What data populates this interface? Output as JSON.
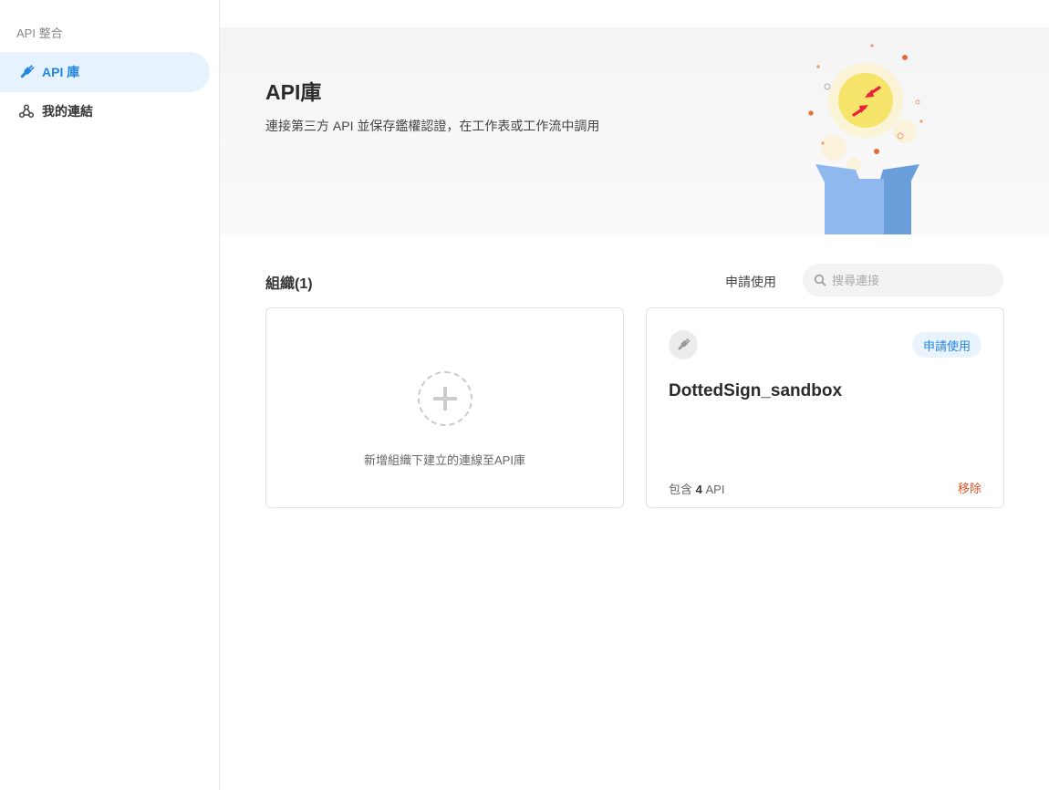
{
  "sidebar": {
    "heading": "API 整合",
    "items": [
      {
        "label": "API 庫",
        "icon": "plug-icon",
        "active": true
      },
      {
        "label": "我的連結",
        "icon": "webhook-icon",
        "active": false
      }
    ]
  },
  "hero": {
    "title": "API庫",
    "subtitle": "連接第三方 API 並保存鑑權認證，在工作表或工作流中調用"
  },
  "section": {
    "title": "組織(1)",
    "apply_label": "申請使用",
    "search_placeholder": "搜尋連接"
  },
  "add_card": {
    "text": "新增組織下建立的連線至API庫"
  },
  "org_card": {
    "name": "DottedSign_sandbox",
    "badge": "申請使用",
    "count_prefix": "包含",
    "count": "4",
    "count_suffix": "API",
    "remove_label": "移除"
  },
  "colors": {
    "accent": "#2386e3",
    "active_bg": "#e6f2fd",
    "remove": "#d4572a",
    "box_light": "#8fb9ee",
    "box_dark": "#6a9fdc",
    "sun": "#f7e46a",
    "arrow": "#e8223a"
  }
}
